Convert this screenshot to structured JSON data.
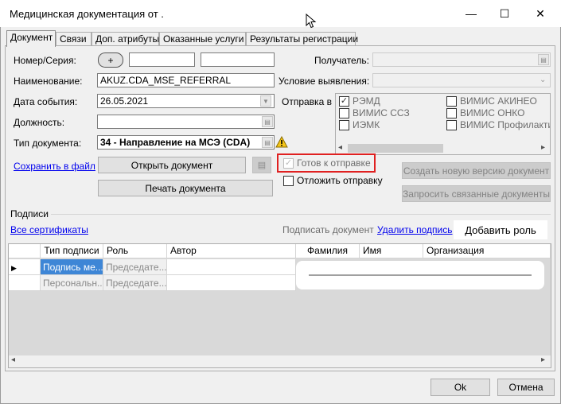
{
  "window": {
    "title": "Медицинская документация от .",
    "minimize": "—",
    "maximize": "☐",
    "close": "✕"
  },
  "tabs": [
    "Документ",
    "Связи",
    "Доп. атрибуты",
    "Оказанные услуги",
    "Результаты регистрации"
  ],
  "form": {
    "number_label": "Номер/Серия:",
    "plus": "+",
    "name_label": "Наименование:",
    "name_value": "AKUZ.CDA_MSE_REFERRAL",
    "date_label": "Дата события:",
    "date_value": "26.05.2021",
    "position_label": "Должность:",
    "doctype_label": "Тип документа:",
    "doctype_value": "34 - Направление на МСЭ (CDA)",
    "recipient_label": "Получатель:",
    "condition_label": "Условие выявления:",
    "send_to_label": "Отправка в"
  },
  "send_targets": [
    {
      "label": "РЭМД",
      "checked": true
    },
    {
      "label": "ВИМИС АКИНЕО",
      "checked": false
    },
    {
      "label": "ВИМИС ССЗ",
      "checked": false
    },
    {
      "label": "ВИМИС ОНКО",
      "checked": false
    },
    {
      "label": "ИЭМК",
      "checked": false
    },
    {
      "label": "ВИМИС Профилактик",
      "checked": false
    }
  ],
  "actions": {
    "save_to_file": "Сохранить в файл",
    "open_document": "Открыть документ",
    "print_document": "Печать документа",
    "ready_to_send": "Готов к отправке",
    "postpone_send": "Отложить отправку",
    "create_version": "Создать новую версию документ",
    "request_linked": "Запросить связанные документы"
  },
  "signatures": {
    "section_title": "Подписи",
    "all_certificates": "Все сертификаты",
    "sign_document": "Подписать документ",
    "delete_signature": "Удалить подпись",
    "add_role": "Добавить роль",
    "columns": [
      "Тип подписи",
      "Роль",
      "Автор",
      "Фамилия",
      "Имя",
      "Организация"
    ],
    "rows": [
      {
        "type": "Подпись ме...",
        "role": "Председате..."
      },
      {
        "type": "Персональн...",
        "role": "Председате..."
      }
    ]
  },
  "footer": {
    "ok": "Ok",
    "cancel": "Отмена"
  },
  "colors": {
    "highlight_border": "#e02020",
    "selected_cell": "#3e86d6"
  }
}
